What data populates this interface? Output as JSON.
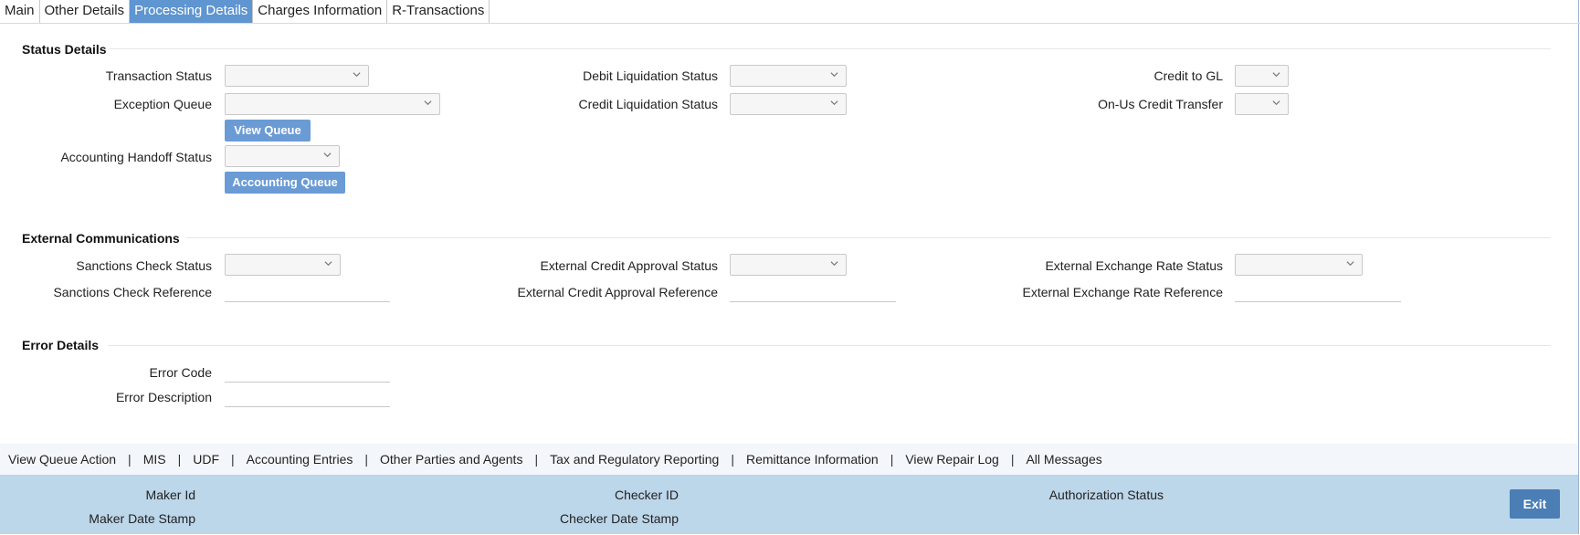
{
  "tabs": [
    {
      "label": "Main"
    },
    {
      "label": "Other Details"
    },
    {
      "label": "Processing Details"
    },
    {
      "label": "Charges Information"
    },
    {
      "label": "R-Transactions"
    }
  ],
  "status_details": {
    "title": "Status Details",
    "transaction_status": "Transaction Status",
    "exception_queue": "Exception Queue",
    "view_queue": "View Queue",
    "accounting_handoff_status": "Accounting Handoff Status",
    "accounting_queue": "Accounting Queue",
    "debit_liquidation_status": "Debit Liquidation Status",
    "credit_liquidation_status": "Credit Liquidation Status",
    "credit_to_gl": "Credit to GL",
    "on_us_credit_transfer": "On-Us Credit Transfer"
  },
  "external_communications": {
    "title": "External Communications",
    "sanctions_check_status": "Sanctions Check Status",
    "sanctions_check_reference": "Sanctions Check Reference",
    "external_credit_approval_status": "External Credit Approval Status",
    "external_credit_approval_reference": "External Credit Approval Reference",
    "external_exchange_rate_status": "External Exchange Rate Status",
    "external_exchange_rate_reference": "External Exchange Rate Reference"
  },
  "error_details": {
    "title": "Error Details",
    "error_code": "Error Code",
    "error_description": "Error Description"
  },
  "bottom_links": [
    {
      "label": "View Queue Action"
    },
    {
      "label": "MIS"
    },
    {
      "label": "UDF"
    },
    {
      "label": "Accounting Entries"
    },
    {
      "label": "Other Parties and Agents"
    },
    {
      "label": "Tax and Regulatory Reporting"
    },
    {
      "label": "Remittance Information"
    },
    {
      "label": "View Repair Log"
    },
    {
      "label": "All Messages"
    }
  ],
  "link_separator": "|",
  "footer": {
    "maker_id": "Maker Id",
    "maker_date_stamp": "Maker Date Stamp",
    "checker_id": "Checker ID",
    "checker_date_stamp": "Checker Date Stamp",
    "authorization_status": "Authorization Status",
    "exit": "Exit"
  },
  "icons": {
    "dropdown": "chevron-down-icon"
  },
  "colors": {
    "active_tab": "#5f95d0",
    "button": "#6a9bd5",
    "footer": "#bcd6ea",
    "exit_button": "#4a7eb5",
    "link_bar": "#f3f6fa"
  }
}
